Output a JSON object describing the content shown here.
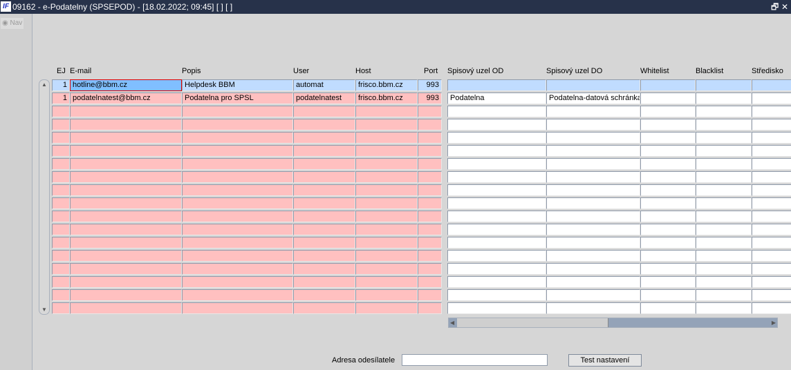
{
  "window": {
    "logo": "IF",
    "title": "09162 - e-Podatelny (SPSEPOD) - [18.02.2022; 09:45]  [ ]  [ ]",
    "restore_icon": "restore-icon",
    "close_icon": "close-icon",
    "restore_glyph": "🗗",
    "close_glyph": "✕"
  },
  "nav": {
    "label": "Nav"
  },
  "left_columns": [
    "EJ",
    "E-mail",
    "Popis",
    "User",
    "Host",
    "Port"
  ],
  "right_columns": [
    "Spisový uzel OD",
    "Spisový uzel DO",
    "Whitelist",
    "Blacklist",
    "Středisko"
  ],
  "rows": [
    {
      "ej": "1",
      "email": "hotline@bbm.cz",
      "popis": "Helpdesk BBM",
      "user": "automat",
      "host": "frisco.bbm.cz",
      "port": "993",
      "od": "",
      "do": "",
      "whitelist": "",
      "blacklist": "",
      "stredisko": ""
    },
    {
      "ej": "1",
      "email": "podatelnatest@bbm.cz",
      "popis": "Podatelna pro SPSL",
      "user": "podatelnatest",
      "host": "frisco.bbm.cz",
      "port": "993",
      "od": "Podatelna",
      "do": "Podatelna-datová schránka",
      "whitelist": "",
      "blacklist": "",
      "stredisko": ""
    }
  ],
  "total_rows": 18,
  "footer": {
    "sender_label": "Adresa odesílatele",
    "sender_value": "",
    "test_button": "Test nastavení"
  }
}
